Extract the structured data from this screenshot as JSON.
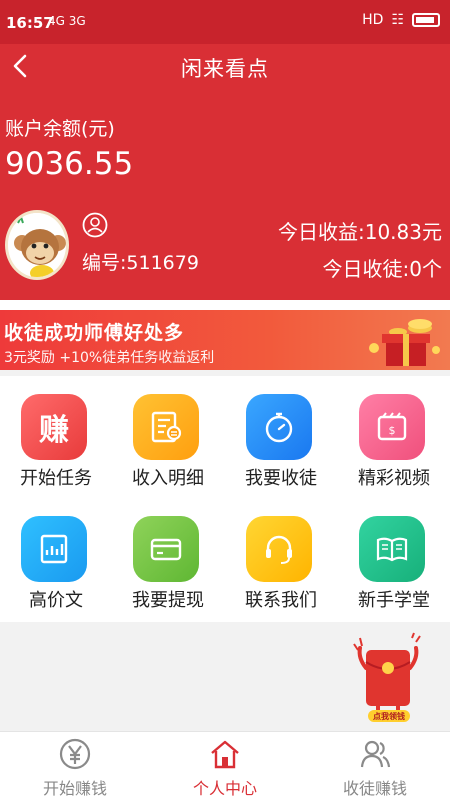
{
  "status_bar": {
    "time": "16:57",
    "signal": "4G 3G",
    "network": "HD"
  },
  "nav": {
    "title": "闲来看点"
  },
  "account": {
    "balance_label": "账户余额(元)",
    "balance_value": "9036.55",
    "user_id": "编号:511679",
    "today_income": "今日收益:10.83元",
    "today_apprentice": "今日收徒:0个"
  },
  "banner": {
    "title": "收徒成功师傅好处多",
    "subtitle": "3元奖励 +10%徒弟任务收益返利"
  },
  "grid": {
    "items": [
      {
        "label": "开始任务",
        "icon": "earn-icon"
      },
      {
        "label": "收入明细",
        "icon": "ledger-icon"
      },
      {
        "label": "我要收徒",
        "icon": "stopwatch-icon"
      },
      {
        "label": "精彩视频",
        "icon": "video-icon"
      },
      {
        "label": "高价文",
        "icon": "article-chart-icon"
      },
      {
        "label": "我要提现",
        "icon": "card-icon"
      },
      {
        "label": "联系我们",
        "icon": "headset-icon"
      },
      {
        "label": "新手学堂",
        "icon": "book-icon"
      }
    ]
  },
  "floating": {
    "badge_text": "点我领钱"
  },
  "tabbar": {
    "tabs": [
      {
        "label": "开始赚钱",
        "icon": "yen-circle-icon",
        "active": false
      },
      {
        "label": "个人中心",
        "icon": "home-icon",
        "active": true
      },
      {
        "label": "收徒赚钱",
        "icon": "users-icon",
        "active": false
      }
    ]
  },
  "colors": {
    "primary_red": "#d92f35",
    "status_red": "#c8232c",
    "tab_inactive": "#888888"
  }
}
